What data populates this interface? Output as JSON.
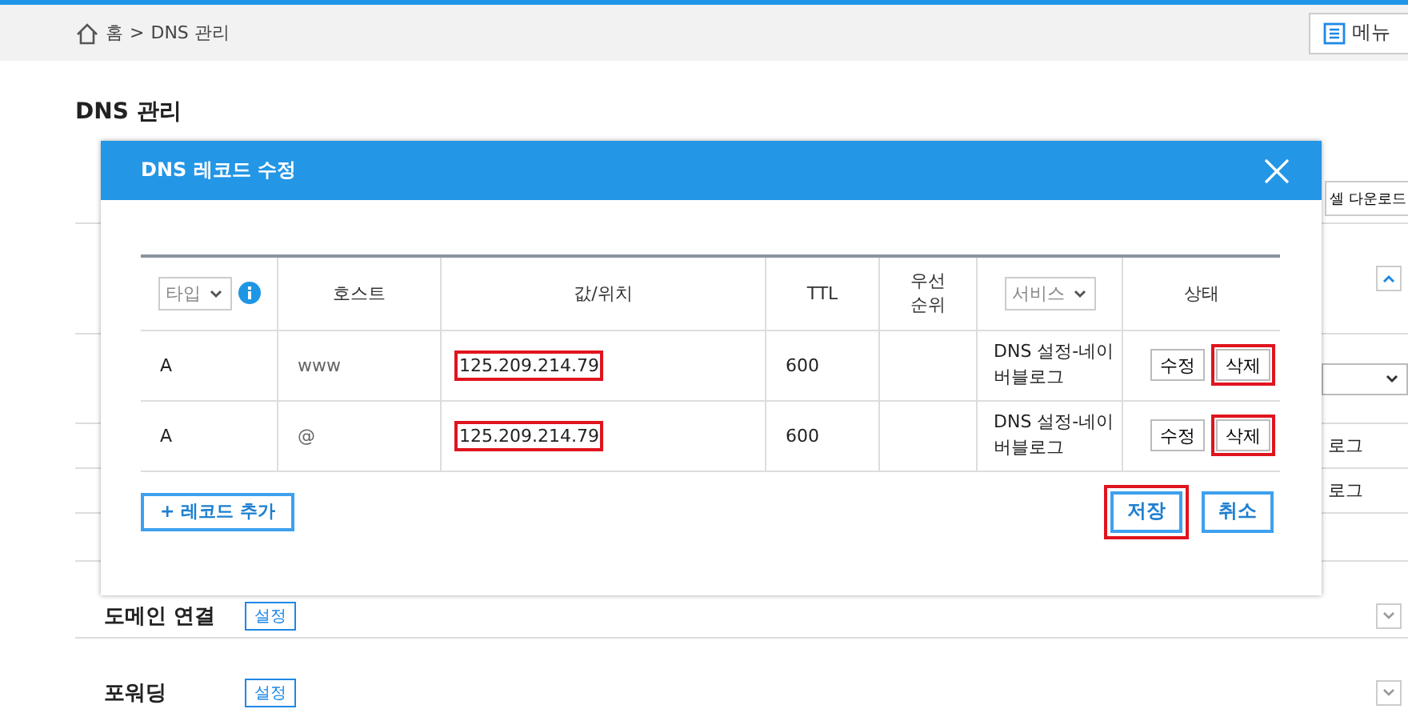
{
  "breadcrumb": {
    "items": [
      "홈",
      "DNS 관리"
    ],
    "separator": ">"
  },
  "menu_button": {
    "label": "메뉴"
  },
  "page_title": "DNS 관리",
  "background": {
    "excel_button": "셀 다운로드",
    "list_texts": [
      "로그",
      "로그"
    ],
    "sections": [
      {
        "title": "도메인 연결",
        "button": "설정"
      },
      {
        "title": "포워딩",
        "button": "설정"
      }
    ]
  },
  "dialog": {
    "title": "DNS 레코드 수정",
    "columns": [
      {
        "kind": "select",
        "label": "타입",
        "info": true
      },
      {
        "kind": "text",
        "label": "호스트"
      },
      {
        "kind": "text",
        "label": "값/위치"
      },
      {
        "kind": "text",
        "label": "TTL"
      },
      {
        "kind": "text",
        "label": "우선 순위"
      },
      {
        "kind": "select",
        "label": "서비스",
        "info": false
      },
      {
        "kind": "text",
        "label": "상태"
      }
    ],
    "rows": [
      {
        "type": "A",
        "host": "www",
        "value": "125.209.214.79",
        "value_highlighted": true,
        "ttl": "600",
        "service": "DNS 설정-네이버블로그",
        "actions": [
          {
            "label": "수정",
            "highlighted": false
          },
          {
            "label": "삭제",
            "highlighted": true
          }
        ]
      },
      {
        "type": "A",
        "host": "@",
        "value": "125.209.214.79",
        "value_highlighted": true,
        "ttl": "600",
        "service": "DNS 설정-네이버블로그",
        "actions": [
          {
            "label": "수정",
            "highlighted": false
          },
          {
            "label": "삭제",
            "highlighted": true
          }
        ]
      }
    ],
    "add_button": "+ 레코드 추가",
    "buttons": [
      {
        "label": "저장",
        "highlighted": true
      },
      {
        "label": "취소",
        "highlighted": false
      }
    ]
  }
}
